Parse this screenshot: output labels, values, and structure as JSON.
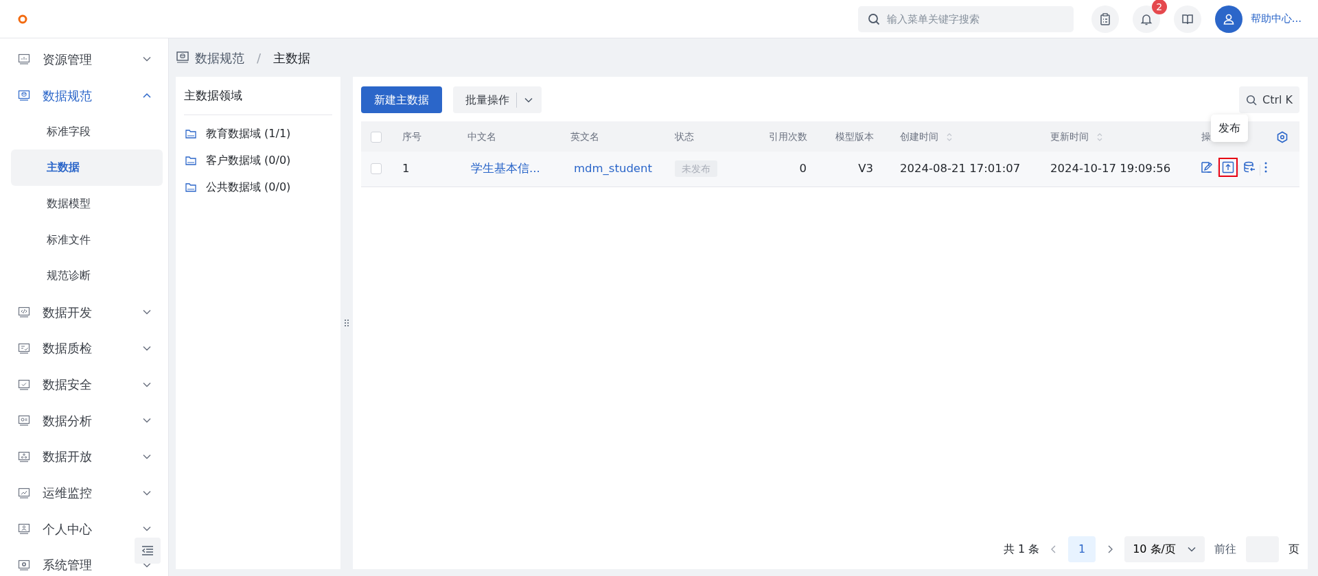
{
  "header": {
    "search": {
      "placeholder": "输入菜单关键字搜索"
    },
    "notification_count": "2",
    "user_label": "帮助中心..."
  },
  "sidebar": {
    "items": [
      {
        "label": "资源管理",
        "expanded": false,
        "selected": false
      },
      {
        "label": "数据规范",
        "expanded": true,
        "selected": true,
        "children": [
          {
            "label": "标准字段",
            "selected": false
          },
          {
            "label": "主数据",
            "selected": true
          },
          {
            "label": "数据模型",
            "selected": false
          },
          {
            "label": "标准文件",
            "selected": false
          },
          {
            "label": "规范诊断",
            "selected": false
          }
        ]
      },
      {
        "label": "数据开发",
        "expanded": false,
        "selected": false
      },
      {
        "label": "数据质检",
        "expanded": false,
        "selected": false
      },
      {
        "label": "数据安全",
        "expanded": false,
        "selected": false
      },
      {
        "label": "数据分析",
        "expanded": false,
        "selected": false
      },
      {
        "label": "数据开放",
        "expanded": false,
        "selected": false
      },
      {
        "label": "运维监控",
        "expanded": false,
        "selected": false
      },
      {
        "label": "个人中心",
        "expanded": false,
        "selected": false
      },
      {
        "label": "系统管理",
        "expanded": false,
        "selected": false
      }
    ]
  },
  "breadcrumb": {
    "items": [
      "数据规范",
      "主数据"
    ],
    "separator": "/"
  },
  "domain_panel": {
    "title": "主数据领域",
    "items": [
      "教育数据域 (1/1)",
      "客户数据域 (0/0)",
      "公共数据域 (0/0)"
    ]
  },
  "toolbar": {
    "primary_button": "新建主数据",
    "batch_button": "批量操作",
    "shortcut": "Ctrl K"
  },
  "table": {
    "columns": [
      {
        "label": "序号",
        "sortable": false
      },
      {
        "label": "中文名",
        "sortable": false
      },
      {
        "label": "英文名",
        "sortable": false
      },
      {
        "label": "状态",
        "sortable": false
      },
      {
        "label": "引用次数",
        "sortable": false
      },
      {
        "label": "模型版本",
        "sortable": false
      },
      {
        "label": "创建时间",
        "sortable": true
      },
      {
        "label": "更新时间",
        "sortable": true
      },
      {
        "label": "操",
        "sortable": false
      }
    ],
    "all_checked": false,
    "rows": [
      {
        "checked": false,
        "cells": [
          "1",
          "学生基本信...",
          "mdm_student",
          "未发布",
          "0",
          "V3",
          "2024-08-21 17:01:07",
          "2024-10-17 19:09:56"
        ],
        "actions": [
          {
            "kind": "edit",
            "highlighted": false
          },
          {
            "kind": "publish",
            "highlighted": true
          },
          {
            "kind": "sync",
            "highlighted": false
          },
          {
            "kind": "more",
            "highlighted": false
          }
        ]
      }
    ]
  },
  "tooltip": "发布",
  "pagination": {
    "total": "共 1 条",
    "pages": [
      {
        "label": "1",
        "selected": true
      }
    ],
    "page_size": "10 条/页",
    "goto_label": "前往",
    "goto_suffix": "页"
  }
}
